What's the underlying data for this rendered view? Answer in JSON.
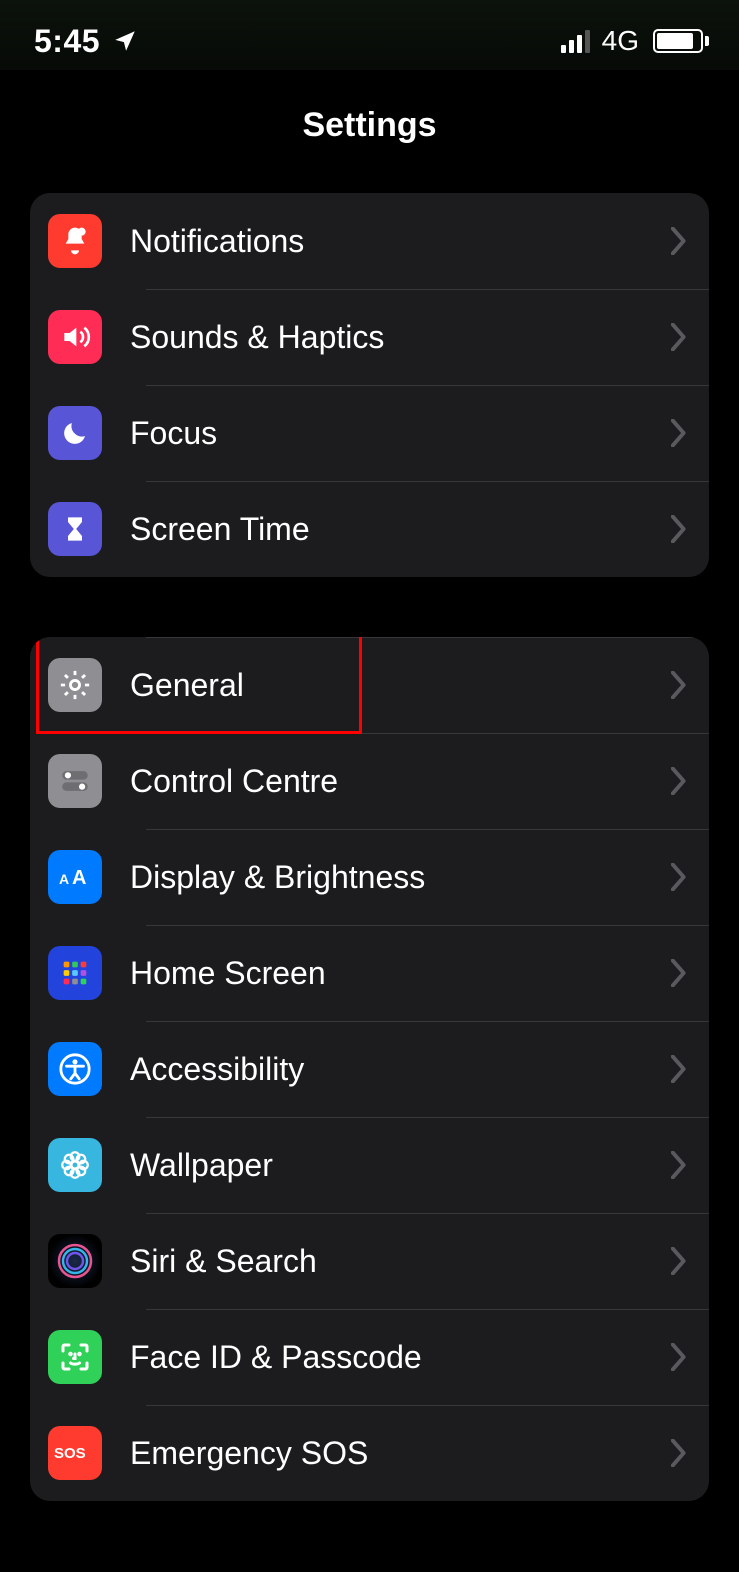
{
  "status": {
    "time": "5:45",
    "location_icon": "location-arrow",
    "network": "4G",
    "signal_bars": 3,
    "signal_total": 4,
    "battery_pct": 80
  },
  "title": "Settings",
  "highlight_row": "general",
  "groups": [
    {
      "id": "group1",
      "rows": [
        {
          "id": "notifications",
          "label": "Notifications",
          "icon": "bell-icon",
          "icon_bg": "bg-red"
        },
        {
          "id": "sounds",
          "label": "Sounds & Haptics",
          "icon": "speaker-icon",
          "icon_bg": "bg-pink"
        },
        {
          "id": "focus",
          "label": "Focus",
          "icon": "moon-icon",
          "icon_bg": "bg-indigo"
        },
        {
          "id": "screentime",
          "label": "Screen Time",
          "icon": "hourglass-icon",
          "icon_bg": "bg-indigo"
        }
      ]
    },
    {
      "id": "group2",
      "rows": [
        {
          "id": "general",
          "label": "General",
          "icon": "gear-icon",
          "icon_bg": "bg-gray"
        },
        {
          "id": "controlcentre",
          "label": "Control Centre",
          "icon": "switches-icon",
          "icon_bg": "bg-gray"
        },
        {
          "id": "display",
          "label": "Display & Brightness",
          "icon": "textsize-icon",
          "icon_bg": "bg-blue"
        },
        {
          "id": "homescreen",
          "label": "Home Screen",
          "icon": "appgrid-icon",
          "icon_bg": "bg-darkblue"
        },
        {
          "id": "accessibility",
          "label": "Accessibility",
          "icon": "accessibility-icon",
          "icon_bg": "bg-blue"
        },
        {
          "id": "wallpaper",
          "label": "Wallpaper",
          "icon": "flower-icon",
          "icon_bg": "bg-cyan"
        },
        {
          "id": "siri",
          "label": "Siri & Search",
          "icon": "siri-icon",
          "icon_bg": "bg-black"
        },
        {
          "id": "faceid",
          "label": "Face ID & Passcode",
          "icon": "faceid-icon",
          "icon_bg": "bg-green"
        },
        {
          "id": "sos",
          "label": "Emergency SOS",
          "icon": "sos-icon",
          "icon_bg": "bg-sosred"
        }
      ]
    }
  ]
}
